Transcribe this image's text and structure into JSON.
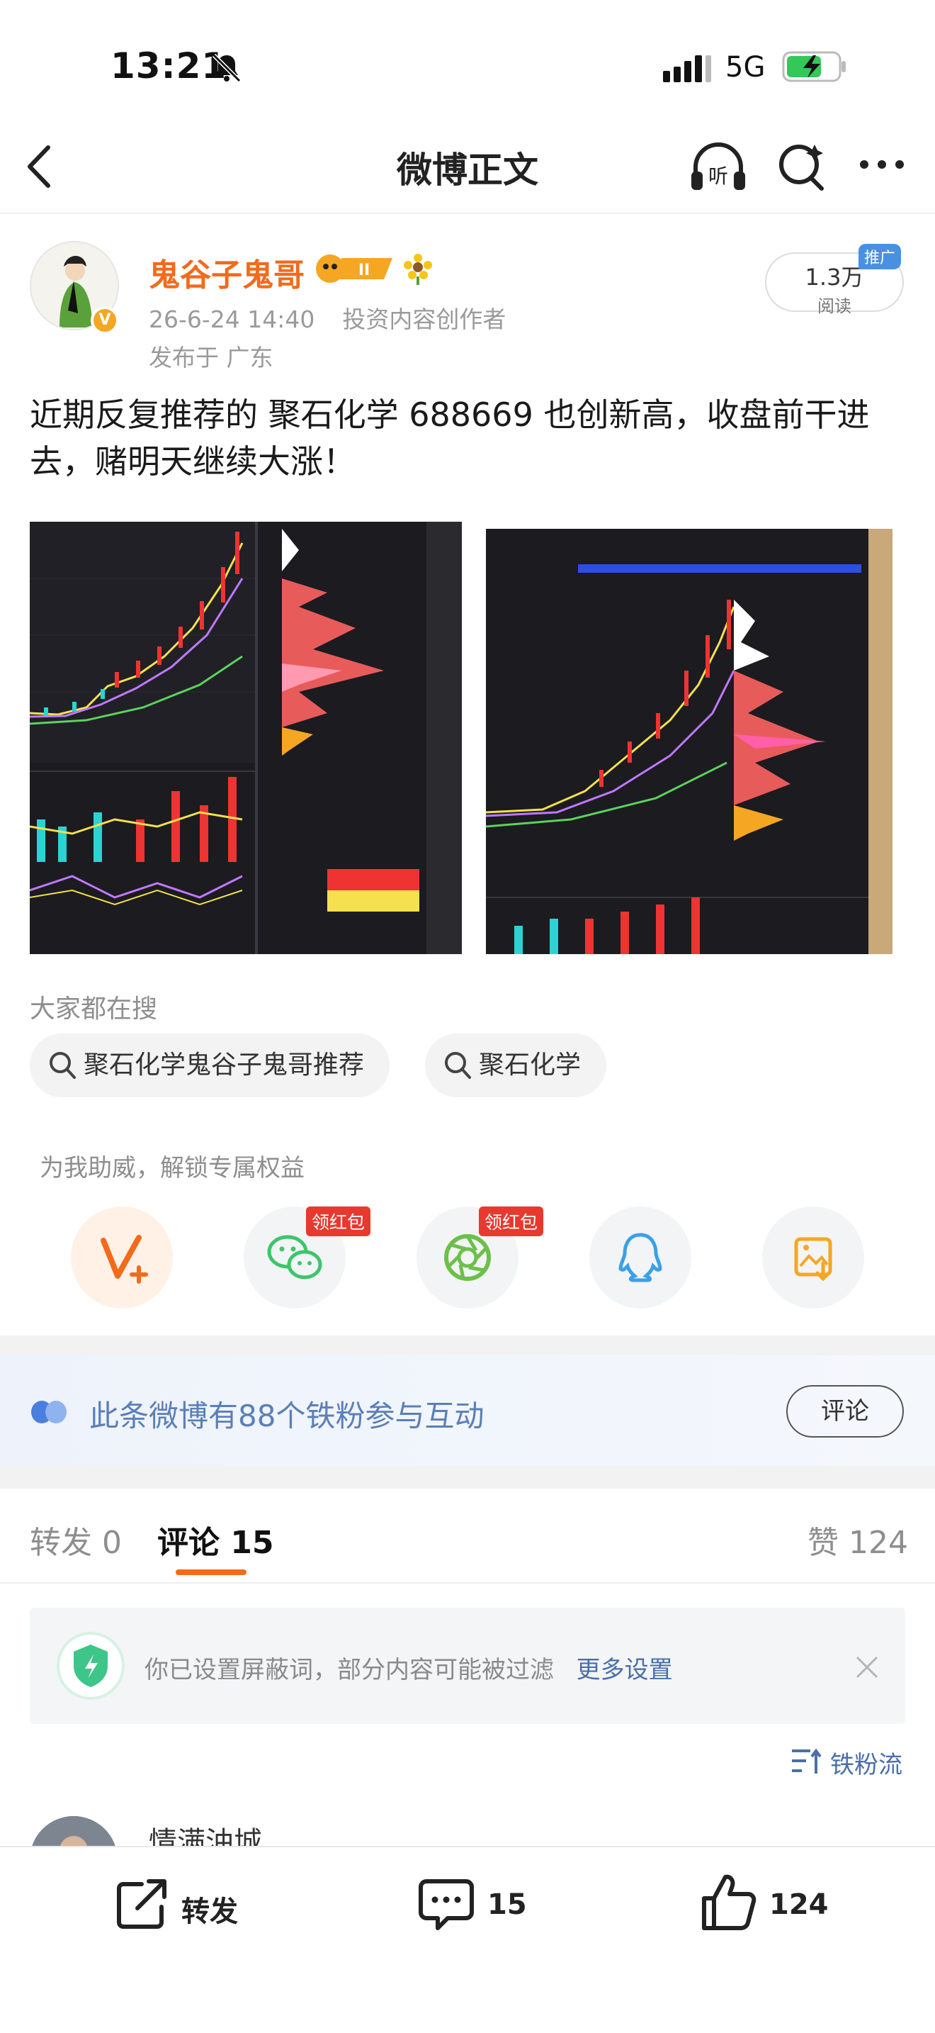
{
  "status_bar": {
    "time": "13:21",
    "network": "5G"
  },
  "nav": {
    "title": "微博正文"
  },
  "author": {
    "name": "鬼谷子鬼哥",
    "timestamp": "26-6-24 14:40",
    "role": "投资内容创作者",
    "location": "发布于 广东",
    "verified_badge": "V"
  },
  "reads": {
    "count": "1.3万",
    "label": "阅读",
    "promo": "推广"
  },
  "post": {
    "text": "近期反复推荐的 聚石化学 688669 也创新高，收盘前干进去，赌明天继续大涨！"
  },
  "search": {
    "heading": "大家都在搜",
    "chips": [
      "聚石化学鬼谷子鬼哥推荐",
      "聚石化学"
    ]
  },
  "boost": {
    "text": "为我助威，解锁专属权益"
  },
  "share": {
    "wechat_tag": "领红包",
    "moments_tag": "领红包"
  },
  "fans": {
    "text": "此条微博有88个铁粉参与互动",
    "button": "评论"
  },
  "tabs": {
    "repost": "转发 0",
    "comments": "评论 15",
    "likes": "赞 124"
  },
  "filter": {
    "text": "你已设置屏蔽词，部分内容可能被过滤",
    "link": "更多设置"
  },
  "sort": {
    "label": "铁粉流"
  },
  "first_comment": {
    "name": "情满油城"
  },
  "bottom_bar": {
    "repost": "转发",
    "comments": "15",
    "likes": "124"
  },
  "colors": {
    "accent_orange": "#f26a1b",
    "link_blue": "#4a6ea9",
    "red_tag": "#e8392f"
  }
}
